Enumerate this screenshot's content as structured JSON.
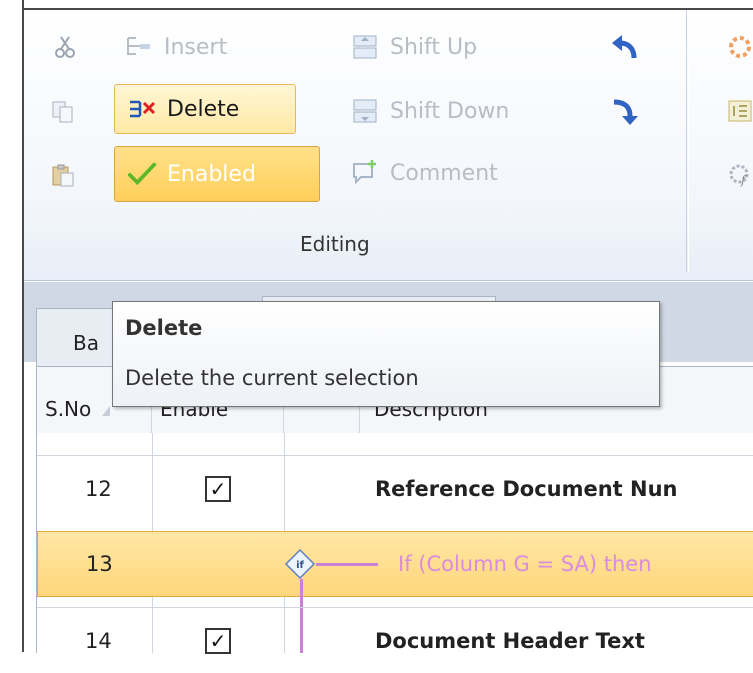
{
  "ribbon": {
    "insert_label": "Insert",
    "delete_label": "Delete",
    "enabled_label": "Enabled",
    "shift_up_label": "Shift Up",
    "shift_down_label": "Shift Down",
    "comment_label": "Comment",
    "group_label": "Editing"
  },
  "tabs": {
    "active_tab_partial": "Ba"
  },
  "grid": {
    "columns": [
      "S.No",
      "Enable",
      "",
      "Description"
    ],
    "rows": [
      {
        "sno": "12",
        "enabled": true,
        "description": "Reference Document Nun"
      },
      {
        "sno": "13",
        "enabled": false,
        "description": "If (Column G = SA) then",
        "selected": true,
        "condition": "if"
      },
      {
        "sno": "14",
        "enabled": true,
        "description": "Document Header Text"
      }
    ]
  },
  "tooltip": {
    "title": "Delete",
    "description": "Delete the current selection"
  },
  "colors": {
    "condition_text": "#d98be0",
    "connector": "#cc7fd6",
    "selection": "#ffd67a"
  }
}
